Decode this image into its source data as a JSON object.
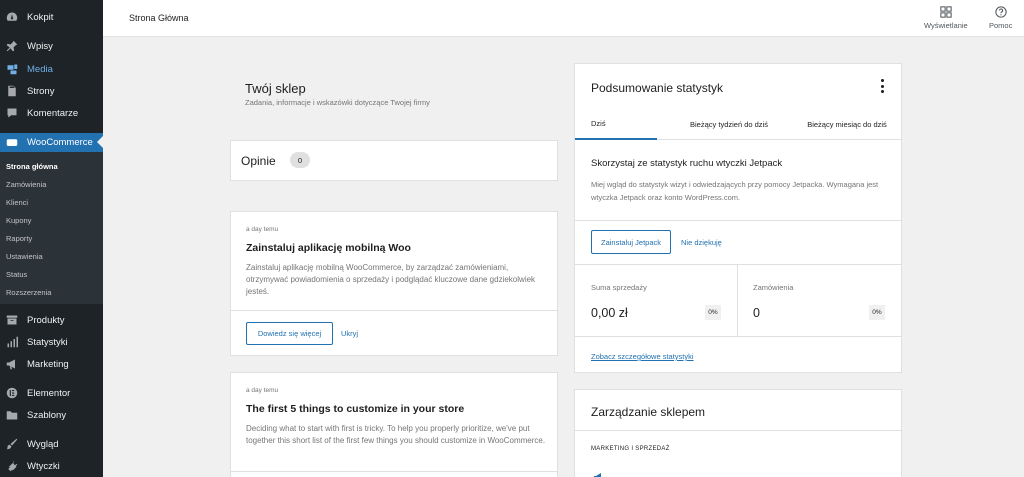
{
  "sidebar": {
    "menu": [
      {
        "label": "Kokpit",
        "icon": "dashboard-icon"
      },
      {
        "label": "Wpisy",
        "icon": "pin-icon"
      },
      {
        "label": "Media",
        "icon": "media-icon"
      },
      {
        "label": "Strony",
        "icon": "page-icon"
      },
      {
        "label": "Komentarze",
        "icon": "comment-icon"
      },
      {
        "label": "WooCommerce",
        "icon": "woocommerce-icon"
      },
      {
        "label": "Produkty",
        "icon": "archive-icon"
      },
      {
        "label": "Statystyki",
        "icon": "bar-chart-icon"
      },
      {
        "label": "Marketing",
        "icon": "megaphone-icon"
      },
      {
        "label": "Elementor",
        "icon": "elementor-icon"
      },
      {
        "label": "Szablony",
        "icon": "folder-icon"
      },
      {
        "label": "Wygląd",
        "icon": "brush-icon"
      },
      {
        "label": "Wtyczki",
        "icon": "plugin-icon"
      }
    ],
    "submenu": [
      "Strona główna",
      "Zamówienia",
      "Klienci",
      "Kupony",
      "Raporty",
      "Ustawienia",
      "Status",
      "Rozszerzenia"
    ]
  },
  "header": {
    "title": "Strona Główna",
    "display_label": "Wyświetlanie",
    "help_label": "Pomoc"
  },
  "shop": {
    "title": "Twój sklep",
    "subtitle": "Zadania, informacje i wskazówki dotyczące Twojej firmy"
  },
  "reviews": {
    "title": "Opinie",
    "count": "0"
  },
  "tasks": [
    {
      "time": "a day temu",
      "title": "Zainstaluj aplikację mobilną Woo",
      "body": "Zainstaluj aplikację mobilną WooCommerce, by zarządzać zamówieniami, otrzymywać powiadomienia o sprzedaży i podglądać kluczowe dane gdziekolwiek jesteś.",
      "primary": "Dowiedz się więcej",
      "secondary": "Ukryj"
    },
    {
      "time": "a day temu",
      "title": "The first 5 things to customize in your store",
      "body": "Deciding what to start with first is tricky. To help you properly prioritize, we've put together this short list of the first few things you should customize in WooCommerce."
    }
  ],
  "stats": {
    "title": "Podsumowanie statystyk",
    "tabs": [
      "Dziś",
      "Bieżący tydzień do dziś",
      "Bieżący miesiąc do dziś"
    ],
    "jetpack_title": "Skorzystaj ze statystyk ruchu wtyczki Jetpack",
    "jetpack_body": "Miej wgląd do statystyk wizyt i odwiedzających przy pomocy Jetpacka. Wymagana jest wtyczka Jetpack oraz konto WordPress.com.",
    "install_label": "Zainstaluj Jetpack",
    "decline_label": "Nie dziękuję",
    "sales_label": "Suma sprzedaży",
    "sales_value": "0,00 zł",
    "sales_delta": "0%",
    "orders_label": "Zamówienia",
    "orders_value": "0",
    "orders_delta": "0%",
    "detail_link": "Zobacz szczegółowe statystyki"
  },
  "management": {
    "title": "Zarządzanie sklepem",
    "section": "MARKETING I SPRZEDAŻ"
  },
  "colors": {
    "sidebar_bg": "#1d2327",
    "accent": "#2271b1",
    "page_bg": "#f0f0f1"
  }
}
